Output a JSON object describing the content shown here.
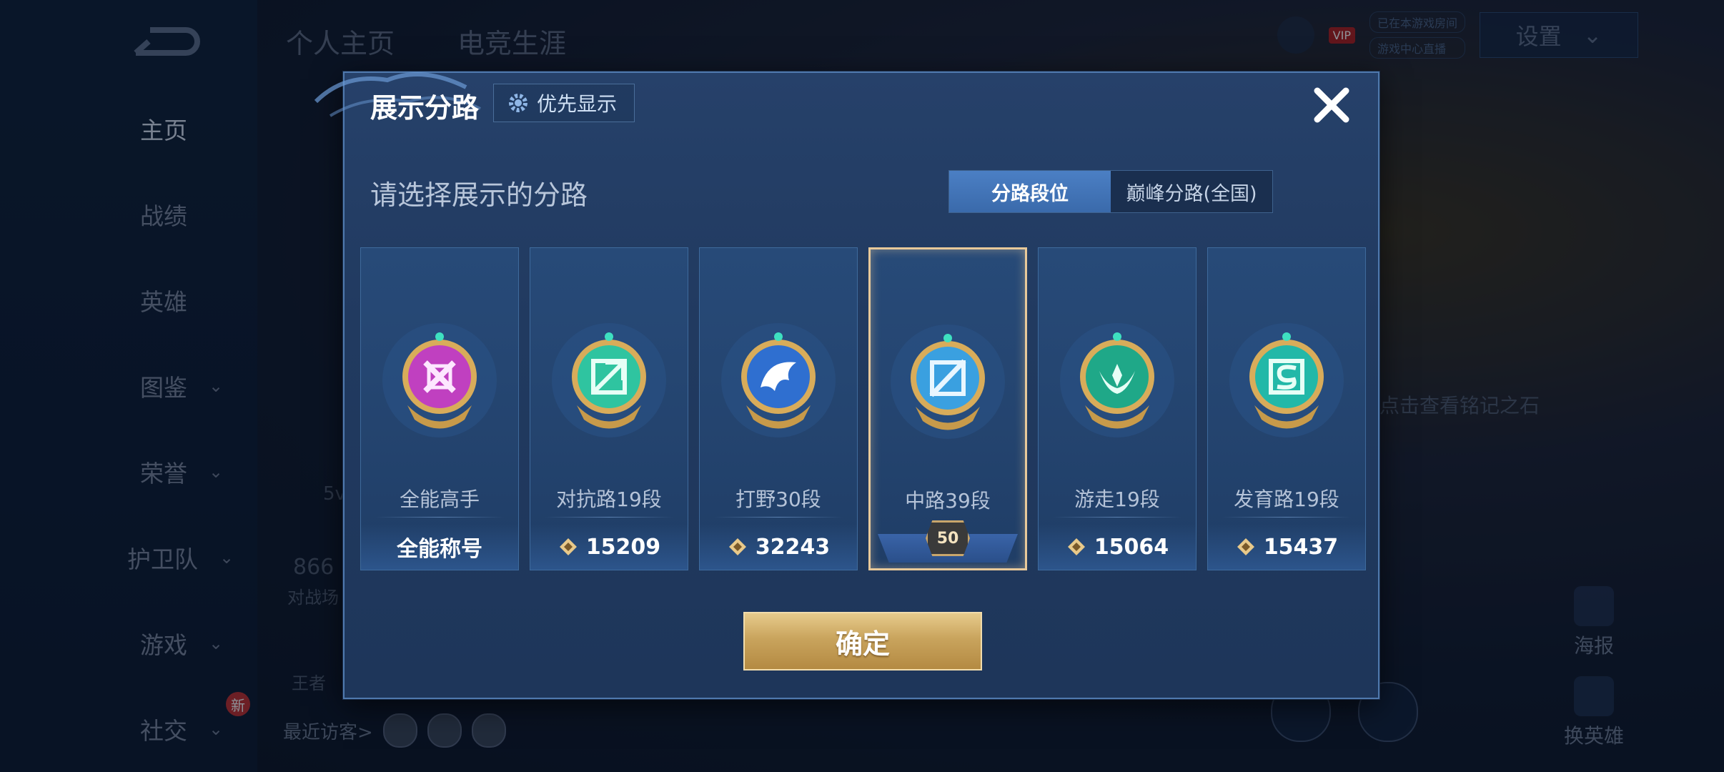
{
  "background": {
    "top_tabs": [
      "个人主页",
      "电竞生涯"
    ],
    "nav_items": [
      {
        "label": "主页",
        "chevron": false
      },
      {
        "label": "战绩",
        "chevron": false
      },
      {
        "label": "英雄",
        "chevron": false
      },
      {
        "label": "图鉴",
        "chevron": true
      },
      {
        "label": "荣誉",
        "chevron": true
      },
      {
        "label": "护卫队",
        "chevron": true
      },
      {
        "label": "游戏",
        "chevron": true
      },
      {
        "label": "社交",
        "chevron": true
      }
    ],
    "new_badge": "新",
    "settings_label": "设置",
    "vip_label": "VIP",
    "status_line_1": "已在本游戏房间",
    "status_line_2": "游戏中心直播",
    "peek_number": "866",
    "peek_text_1": "对战场",
    "peek_text_2": "王者",
    "peek_5v": "5v",
    "inscription_hint": "点击查看铭记之石",
    "recent_visitors": "最近访客>",
    "right_buttons": [
      "海报",
      "换英雄"
    ]
  },
  "modal": {
    "title": "展示分路",
    "priority_label": "优先显示",
    "subtitle": "请选择展示的分路",
    "toggle": [
      "分路段位",
      "巅峰分路(全国)"
    ],
    "toggle_active": 0,
    "cards": [
      {
        "lane": "全能高手",
        "value": "全能称号",
        "type": "title",
        "color": "#c040c0"
      },
      {
        "lane": "对抗路19段",
        "value": "15209",
        "type": "points",
        "color": "#2fc4a0"
      },
      {
        "lane": "打野30段",
        "value": "32243",
        "type": "points",
        "color": "#2f6fd0"
      },
      {
        "lane": "中路39段",
        "value": "50",
        "type": "rank",
        "color": "#3aa0e0"
      },
      {
        "lane": "游走19段",
        "value": "15064",
        "type": "points",
        "color": "#1fa888"
      },
      {
        "lane": "发育路19段",
        "value": "15437",
        "type": "points",
        "color": "#22b8a8"
      }
    ],
    "selected_index": 3,
    "confirm_label": "确定"
  }
}
